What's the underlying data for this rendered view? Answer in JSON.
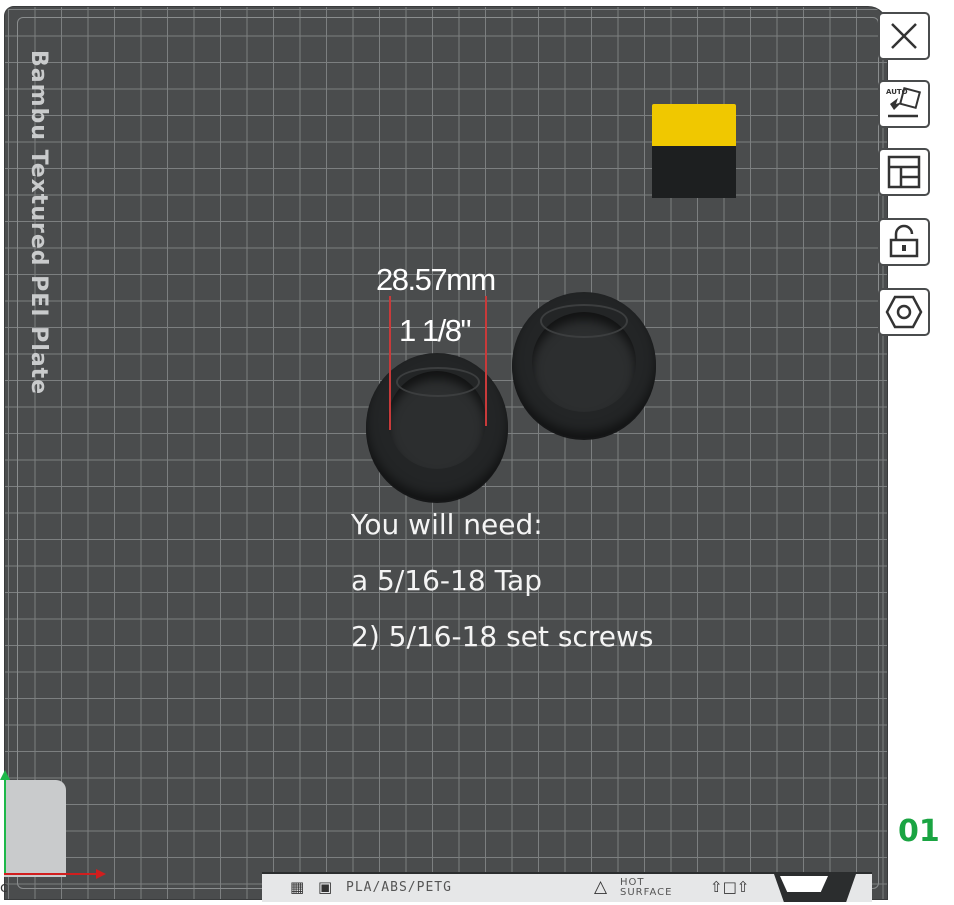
{
  "plate": {
    "name": "Bambu Textured PEI Plate",
    "index": "01",
    "filament_spec": "PLA/ABS/PETG",
    "hot_surface_line1": "HOT",
    "hot_surface_line2": "SURFACE"
  },
  "measurement": {
    "metric": "28.57mm",
    "imperial": "1 1/8\""
  },
  "note": {
    "line1": "You will need:",
    "line2": "a 5/16-18 Tap",
    "line3": "2) 5/16-18 set screws"
  },
  "toolbar": {
    "buttons": [
      {
        "icon": "close-icon"
      },
      {
        "icon": "auto-orient-icon",
        "label": "AUTO"
      },
      {
        "icon": "arrange-icon"
      },
      {
        "icon": "lock-icon"
      },
      {
        "icon": "settings-hex-icon"
      }
    ]
  },
  "colors": {
    "plate": "#4a4c4d",
    "grid": "#7c7f80",
    "accent_green": "#1aa442",
    "filament_yellow": "#f0c800",
    "dimension_red": "#c83a3a"
  }
}
